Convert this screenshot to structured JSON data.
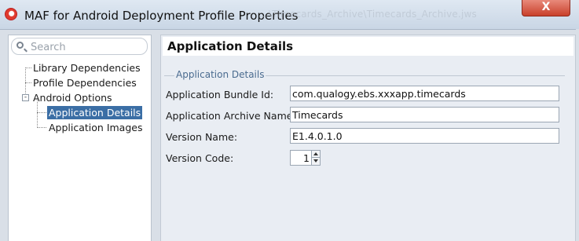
{
  "window": {
    "title": "MAF for Android Deployment Profile Properties",
    "ghost_title": "...\\Timecards_Archive\\Timecards_Archive.jws",
    "close_label": "X"
  },
  "sidebar": {
    "search_placeholder": "Search",
    "items": [
      {
        "label": "Library Dependencies"
      },
      {
        "label": "Profile Dependencies"
      },
      {
        "label": "Android Options",
        "expander": "-"
      },
      {
        "label": "Application Details",
        "selected": true
      },
      {
        "label": "Application Images"
      }
    ]
  },
  "main": {
    "page_title": "Application Details",
    "group_title": "Application Details",
    "fields": {
      "bundle_id": {
        "label": "Application Bundle Id:",
        "value": "com.qualogy.ebs.xxxapp.timecards"
      },
      "archive_name": {
        "label": "Application Archive Name:",
        "value": "Timecards"
      },
      "version_name": {
        "label": "Version Name:",
        "value": "E1.4.0.1.0"
      },
      "version_code": {
        "label": "Version Code:",
        "value": "1"
      }
    }
  },
  "colors": {
    "selection": "#3b6ea5",
    "close_button": "#c9402b",
    "group_title": "#4a6b8f"
  }
}
